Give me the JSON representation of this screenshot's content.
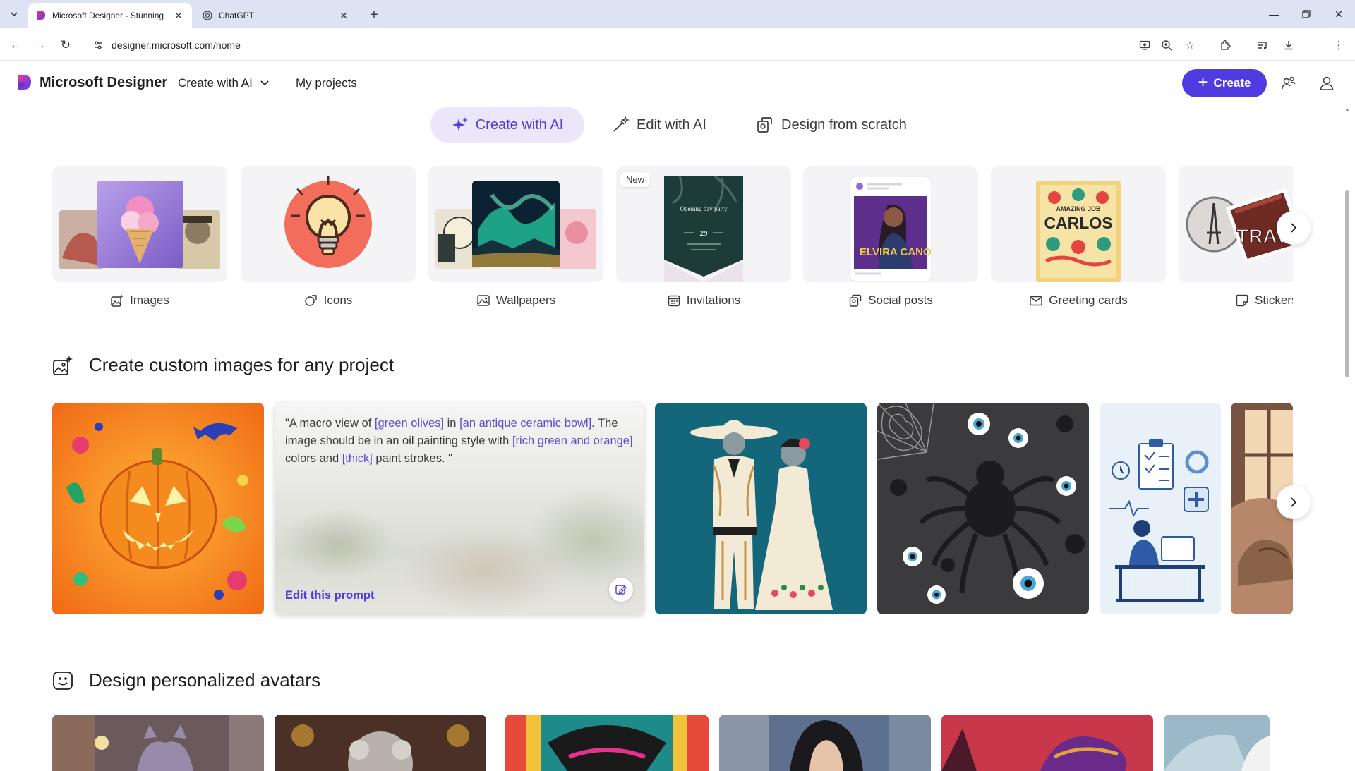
{
  "browser": {
    "tabs": [
      {
        "title": "Microsoft Designer - Stunning",
        "active": true,
        "favicon": "designer-logo"
      },
      {
        "title": "ChatGPT",
        "active": false,
        "favicon": "chatgpt-logo"
      }
    ],
    "url": "designer.microsoft.com/home"
  },
  "header": {
    "brand": "Microsoft Designer",
    "nav": [
      {
        "label": "Create with AI",
        "has_dropdown": true
      },
      {
        "label": "My projects"
      }
    ],
    "create_label": "Create"
  },
  "modes": [
    {
      "label": "Create with AI",
      "icon": "sparkle-icon",
      "active": true
    },
    {
      "label": "Edit with AI",
      "icon": "magic-wand-icon"
    },
    {
      "label": "Design from scratch",
      "icon": "design-icon"
    }
  ],
  "categories": [
    {
      "label": "Images",
      "icon": "image-sparkle-icon"
    },
    {
      "label": "Icons",
      "icon": "icon-shape-icon"
    },
    {
      "label": "Wallpapers",
      "icon": "wallpaper-icon"
    },
    {
      "label": "Invitations",
      "icon": "calendar-icon",
      "badge": "New",
      "thumb_text": {
        "title": "Opening day party",
        "date": "29"
      }
    },
    {
      "label": "Social posts",
      "icon": "social-post-icon",
      "thumb_text": {
        "name": "ELVIRA CANO"
      }
    },
    {
      "label": "Greeting cards",
      "icon": "envelope-icon",
      "thumb_text": {
        "line1": "AMAZING JOB",
        "line2": "CARLOS"
      }
    },
    {
      "label": "Stickers",
      "icon": "sticker-icon",
      "thumb_text": {
        "word": "TRAVEL"
      }
    }
  ],
  "section_images": {
    "title": "Create custom images for any project",
    "icon": "image-sparkle-icon",
    "prompt": {
      "parts": [
        {
          "t": "\"A macro view of ",
          "hl": false
        },
        {
          "t": "[green olives]",
          "hl": true
        },
        {
          "t": " in ",
          "hl": false
        },
        {
          "t": "[an antique ceramic bowl]",
          "hl": true
        },
        {
          "t": ". The image should be in an oil painting style with ",
          "hl": false
        },
        {
          "t": "[rich green and orange]",
          "hl": true
        },
        {
          "t": " colors and ",
          "hl": false
        },
        {
          "t": "[thick]",
          "hl": true
        },
        {
          "t": " paint strokes. \"",
          "hl": false
        }
      ],
      "edit_label": "Edit this prompt"
    }
  },
  "section_avatars": {
    "title": "Design personalized avatars",
    "icon": "avatar-icon"
  },
  "colors": {
    "accent": "#4f3ce0",
    "accent_soft": "#ece6fb",
    "highlight_text": "#5b4bd6",
    "tab_strip": "#dde3f2"
  }
}
